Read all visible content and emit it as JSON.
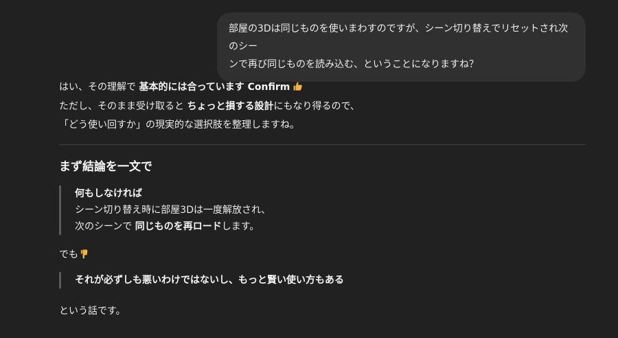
{
  "user_message": {
    "line1": "部屋の3Dは同じものを使いまわすのですが、シーン切り替えでリセットされ次のシー",
    "line2": "ンで再び同じものを読み込む、ということになりますね？"
  },
  "assistant": {
    "intro": {
      "l1_pre": "はい、その理解で ",
      "l1_bold": "基本的には合っています Confirm",
      "l1_icon": "thumbs-up-icon",
      "l2_pre": "ただし、そのまま受け取ると ",
      "l2_bold": "ちょっと損する設計",
      "l2_post": "にもなり得るので、",
      "l3": "「どう使い回すか」の現実的な選択肢を整理しますね。"
    },
    "heading": "まず結論を一文で",
    "quote1": {
      "title": "何もしなければ",
      "l1": "シーン切り替え時に部屋3Dは一度解放され、",
      "l2_pre": "次のシーンで ",
      "l2_bold": "同じものを再ロード",
      "l2_post": "します。"
    },
    "but": "でも",
    "but_icon": "pointing-down-icon",
    "quote2": "それが必ずしも悪いわけではないし、もっと賢い使い方もある",
    "closing": "という話です。"
  }
}
